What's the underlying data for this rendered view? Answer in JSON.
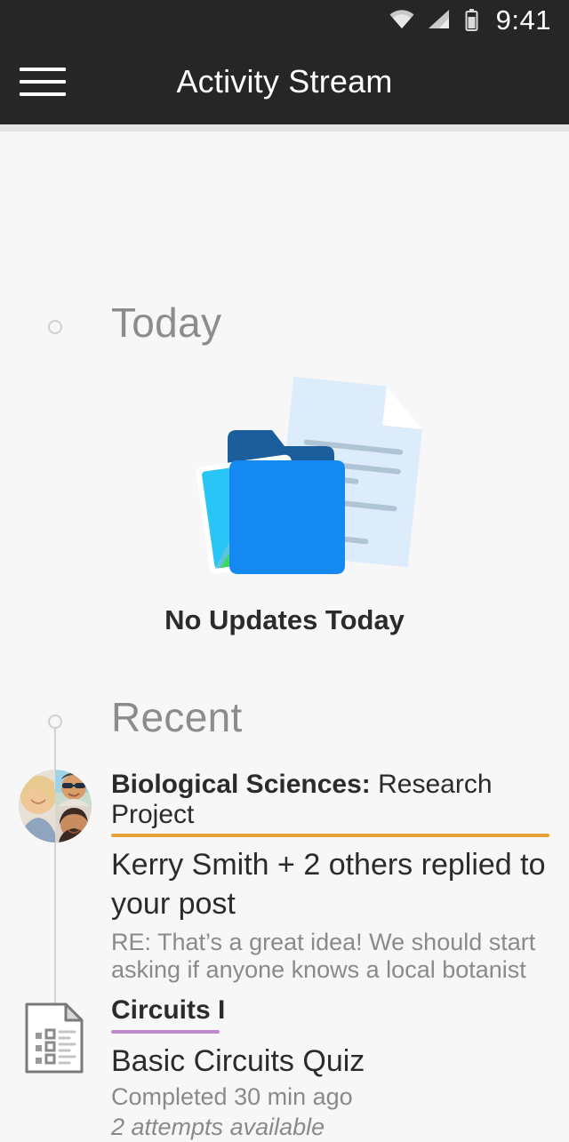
{
  "statusbar": {
    "time": "9:41",
    "icons": [
      "wifi-icon",
      "cellular-signal-icon",
      "battery-icon"
    ]
  },
  "appbar": {
    "menu_icon": "hamburger-menu-icon",
    "title": "Activity Stream"
  },
  "sections": [
    {
      "id": "today",
      "heading": "Today",
      "empty_state": {
        "illustration": "empty-folder-document-photo-illustration",
        "label": "No Updates Today"
      }
    },
    {
      "id": "recent",
      "heading": "Recent"
    }
  ],
  "activities": [
    {
      "icon": "group-avatar",
      "course_bold": "Biological Sciences:",
      "course_plain": " Research Project",
      "accent_color": "#E9A13A",
      "headline": "Kerry Smith + 2 others replied to your post",
      "sub": "RE: That’s a great idea! We should start asking if anyone knows a local botanist",
      "meta": "",
      "meta_italic": ""
    },
    {
      "icon": "quiz-document-icon",
      "course_bold": "Circuits I",
      "course_plain": "",
      "accent_color": "#BC8ACB",
      "headline": "Basic Circuits Quiz",
      "sub": "",
      "meta": "Completed 30 min ago",
      "meta_italic": "2 attempts available"
    }
  ],
  "colors": {
    "appbar_bg": "#262626",
    "page_bg": "#F7F7F7",
    "heading_gray": "#8C8C8C",
    "body_text": "#2B2B2B",
    "muted_text": "#8A8A8A",
    "rail": "#D2D2D2"
  }
}
